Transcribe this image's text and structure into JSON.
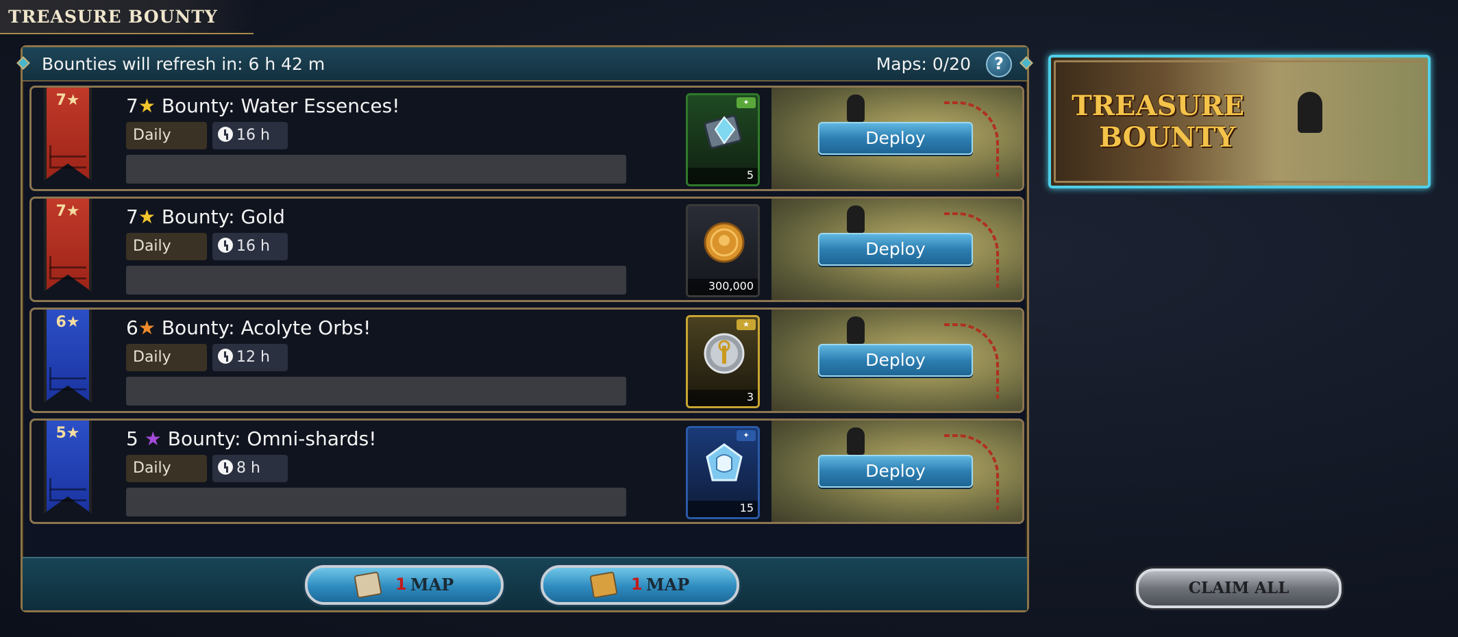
{
  "header": {
    "title": "TREASURE BOUNTY"
  },
  "panel": {
    "refresh_text": "Bounties will refresh in: 6 h 42 m",
    "maps_count": "Maps: 0/20",
    "help_label": "?"
  },
  "bounties": [
    {
      "rank_label": "7★",
      "banner_color": "#c23a2a",
      "stars": "7",
      "star_glyph": "★",
      "star_color": "#f2c52c",
      "title": " Bounty: Water Essences!",
      "frequency": "Daily",
      "duration": "16 h",
      "reward_qty": "5",
      "reward_icon": "water-essence-icon",
      "deploy_label": "Deploy"
    },
    {
      "rank_label": "7★",
      "banner_color": "#c23a2a",
      "stars": "7",
      "star_glyph": "★",
      "star_color": "#f2c52c",
      "title": " Bounty: Gold",
      "frequency": "Daily",
      "duration": "16 h",
      "reward_qty": "300,000",
      "reward_icon": "gold-coin-icon",
      "deploy_label": "Deploy"
    },
    {
      "rank_label": "6★",
      "banner_color": "#2c50c8",
      "stars": "6",
      "star_glyph": "★",
      "star_color": "#f08a2a",
      "title": " Bounty: Acolyte Orbs!",
      "frequency": "Daily",
      "duration": "12 h",
      "reward_qty": "3",
      "reward_icon": "acolyte-orb-icon",
      "deploy_label": "Deploy"
    },
    {
      "rank_label": "5★",
      "banner_color": "#2c50c8",
      "stars": "5",
      "star_glyph": "★",
      "star_color": "#a44ad8",
      "title": " Bounty: Omni-shards!",
      "frequency": "Daily",
      "duration": "8 h",
      "reward_qty": "15",
      "reward_icon": "omni-shard-icon",
      "deploy_label": "Deploy"
    }
  ],
  "footer": {
    "map_buttons": [
      {
        "count": "1",
        "label": "MAP",
        "icon": "plain-map-icon"
      },
      {
        "count": "1",
        "label": "MAP",
        "icon": "gold-map-icon"
      }
    ]
  },
  "side_banner": {
    "line1": "TREASURE",
    "line2": "BOUNTY"
  },
  "claim_all_label": "CLAIM ALL"
}
